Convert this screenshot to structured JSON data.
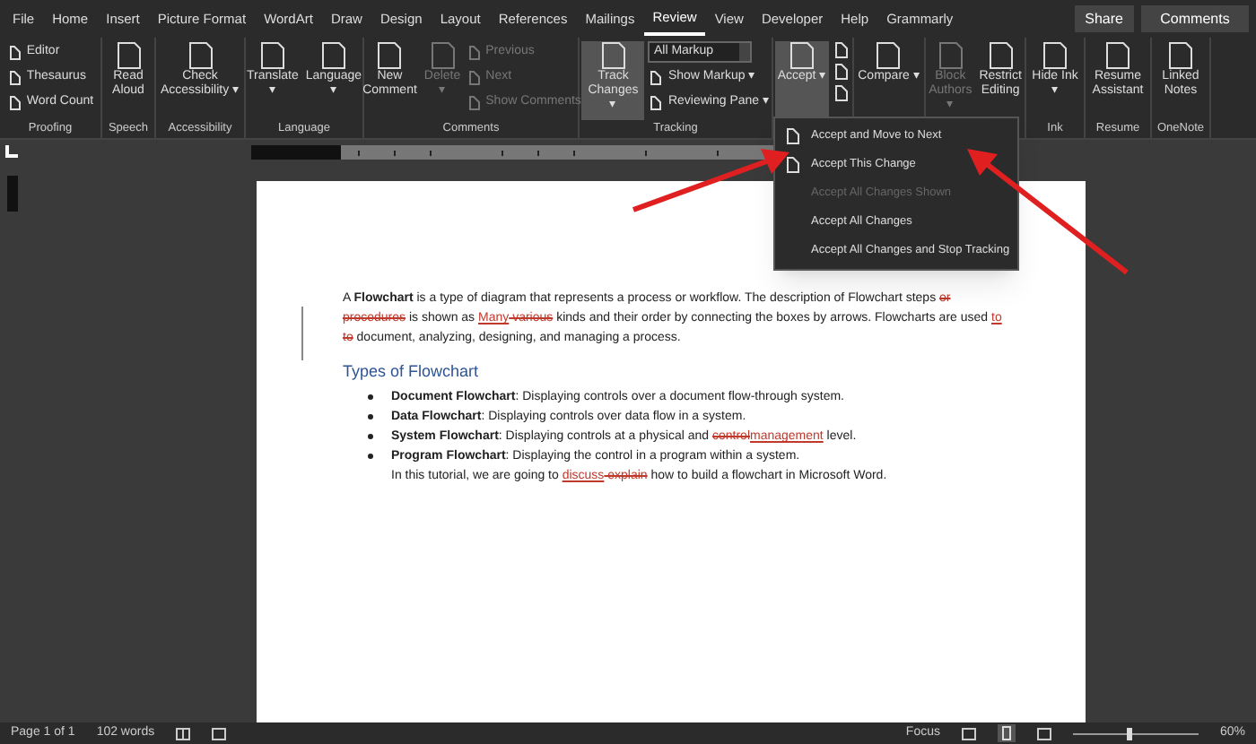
{
  "menu_tabs": [
    {
      "label": "File",
      "selected": false
    },
    {
      "label": "Home",
      "selected": false
    },
    {
      "label": "Insert",
      "selected": false
    },
    {
      "label": "Picture Format",
      "selected": false
    },
    {
      "label": "WordArt",
      "selected": false
    },
    {
      "label": "Draw",
      "selected": false
    },
    {
      "label": "Design",
      "selected": false
    },
    {
      "label": "Layout",
      "selected": false
    },
    {
      "label": "References",
      "selected": false
    },
    {
      "label": "Mailings",
      "selected": false
    },
    {
      "label": "Review",
      "selected": true
    },
    {
      "label": "View",
      "selected": false
    },
    {
      "label": "Developer",
      "selected": false
    },
    {
      "label": "Help",
      "selected": false
    },
    {
      "label": "Grammarly",
      "selected": false
    }
  ],
  "header_buttons": [
    "Share",
    "Comments"
  ],
  "ribbon_groups": [
    {
      "label": "Proofing",
      "items": [
        {
          "kind": "small",
          "label": "Editor",
          "disabled": false,
          "pressed": false
        },
        {
          "kind": "small",
          "label": "Thesaurus",
          "disabled": false,
          "pressed": false
        },
        {
          "kind": "small",
          "label": "Word Count",
          "disabled": false,
          "pressed": false
        }
      ]
    },
    {
      "label": "Speech",
      "items": [
        {
          "kind": "large",
          "label": "Read Aloud",
          "disabled": false,
          "pressed": false
        }
      ]
    },
    {
      "label": "Accessibility",
      "items": [
        {
          "kind": "large",
          "label": "Check Accessibility ▾",
          "disabled": false,
          "pressed": false
        }
      ]
    },
    {
      "label": "Language",
      "items": [
        {
          "kind": "large",
          "label": "Translate ▾",
          "disabled": false,
          "pressed": false
        },
        {
          "kind": "large",
          "label": "Language ▾",
          "disabled": false,
          "pressed": false
        }
      ]
    },
    {
      "label": "Comments",
      "items": [
        {
          "kind": "large",
          "label": "New Comment",
          "disabled": false,
          "pressed": false
        },
        {
          "kind": "large",
          "label": "Delete ▾",
          "disabled": true,
          "pressed": false
        },
        {
          "kind": "small",
          "label": "Previous",
          "disabled": true,
          "pressed": false
        },
        {
          "kind": "small",
          "label": "Next",
          "disabled": true,
          "pressed": false
        },
        {
          "kind": "small",
          "label": "Show Comments",
          "disabled": true,
          "pressed": false
        }
      ]
    },
    {
      "label": "Tracking",
      "items": [
        {
          "kind": "large",
          "label": "Track Changes ▾",
          "disabled": false,
          "pressed": true
        },
        {
          "kind": "dropdown",
          "label": "All Markup",
          "disabled": false,
          "pressed": false
        },
        {
          "kind": "small",
          "label": "Show Markup ▾",
          "disabled": false,
          "pressed": false
        },
        {
          "kind": "small",
          "label": "Reviewing Pane ▾",
          "disabled": false,
          "pressed": false
        }
      ]
    },
    {
      "items": [
        {
          "kind": "large",
          "label": "Accept ▾",
          "disabled": false,
          "pressed": true
        },
        {
          "kind": "icon",
          "disabled": false,
          "pressed": false
        },
        {
          "kind": "icon",
          "disabled": false,
          "pressed": false
        },
        {
          "kind": "icon",
          "disabled": false,
          "pressed": false
        }
      ]
    },
    {
      "items": [
        {
          "kind": "large",
          "label": "Compare ▾",
          "disabled": false,
          "pressed": false
        }
      ]
    },
    {
      "items": [
        {
          "kind": "large",
          "label": "Block Authors ▾",
          "disabled": true,
          "pressed": false
        },
        {
          "kind": "large",
          "label": "Restrict Editing",
          "disabled": false,
          "pressed": false
        }
      ]
    },
    {
      "label": "Ink",
      "items": [
        {
          "kind": "large",
          "label": "Hide Ink ▾",
          "disabled": false,
          "pressed": false
        }
      ]
    },
    {
      "label": "Resume",
      "items": [
        {
          "kind": "large",
          "label": "Resume Assistant",
          "disabled": false,
          "pressed": false
        }
      ]
    },
    {
      "label": "OneNote",
      "items": [
        {
          "kind": "large",
          "label": "Linked Notes",
          "disabled": false,
          "pressed": false
        }
      ]
    }
  ],
  "accept_menu": [
    {
      "label": "Accept and Move to Next",
      "disabled": false
    },
    {
      "label": "Accept This Change",
      "disabled": false
    },
    {
      "label": "Accept All Changes Shown",
      "disabled": true
    },
    {
      "label": "Accept All Changes",
      "disabled": false
    },
    {
      "label": "Accept All Changes and Stop Tracking",
      "disabled": false
    }
  ],
  "document": {
    "paragraphs": [
      {
        "kind": "body",
        "segments": [
          {
            "kind": "normal",
            "text": "A "
          },
          {
            "kind": "bold",
            "text": "Flowchart"
          },
          {
            "kind": "normal",
            "text": " is a type of diagram that represents a process or workflow. The description of Flowchart steps "
          },
          {
            "kind": "deleted",
            "text": "or procedures"
          },
          {
            "kind": "normal",
            "text": " is shown as "
          },
          {
            "kind": "inserted",
            "text": "Many"
          },
          {
            "kind": "deleted",
            "text": " various"
          },
          {
            "kind": "normal",
            "text": " kinds and their order by connecting the boxes by arrows. Flowcharts are used "
          },
          {
            "kind": "inserted",
            "text": " to"
          },
          {
            "kind": "deleted",
            "text": " to"
          },
          {
            "kind": "normal",
            "text": " document, analyzing, designing, and managing a process."
          }
        ]
      },
      {
        "kind": "heading",
        "segments": [
          {
            "kind": "normal",
            "text": "Types of Flowchart"
          }
        ]
      },
      {
        "kind": "bullet",
        "segments": [
          {
            "kind": "bold",
            "text": "Document Flowchart"
          },
          {
            "kind": "normal",
            "text": ": Displaying controls over a document flow-through system."
          }
        ]
      },
      {
        "kind": "bullet",
        "segments": [
          {
            "kind": "bold",
            "text": "Data Flowchart"
          },
          {
            "kind": "normal",
            "text": ": Displaying controls over data flow in a system."
          }
        ]
      },
      {
        "kind": "bullet",
        "segments": [
          {
            "kind": "bold",
            "text": "System Flowchart"
          },
          {
            "kind": "normal",
            "text": ": Displaying controls at a physical and "
          },
          {
            "kind": "deleted",
            "text": "control"
          },
          {
            "kind": "inserted",
            "text": "management"
          },
          {
            "kind": "normal",
            "text": " level."
          }
        ]
      },
      {
        "kind": "bullet",
        "segments": [
          {
            "kind": "bold",
            "text": "Program Flowchart"
          },
          {
            "kind": "normal",
            "text": ": Displaying the control in a program within a system."
          }
        ]
      },
      {
        "kind": "indented",
        "segments": [
          {
            "kind": "normal",
            "text": "In this tutorial, we are going to "
          },
          {
            "kind": "inserted",
            "text": "discuss"
          },
          {
            "kind": "deleted",
            "text": " explain"
          },
          {
            "kind": "normal",
            "text": " how to build a flowchart in Microsoft Word."
          }
        ]
      }
    ]
  },
  "status_bar": {
    "page": "Page 1 of 1",
    "words": "102 words",
    "focus": "Focus",
    "zoom": "60%",
    "zoom_slider": {
      "level": 0.45
    }
  }
}
